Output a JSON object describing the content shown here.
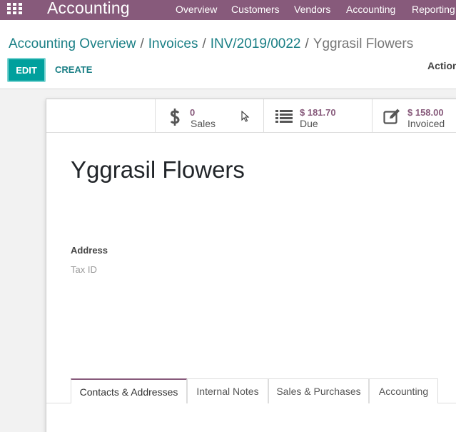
{
  "topbar": {
    "app_title": "Accounting",
    "menu": [
      "Overview",
      "Customers",
      "Vendors",
      "Accounting",
      "Reporting"
    ],
    "apps_icon": "grid-icon"
  },
  "breadcrumb": {
    "items": [
      "Accounting Overview",
      "Invoices",
      "INV/2019/0022"
    ],
    "separator": "/",
    "current": "Yggrasil Flowers"
  },
  "buttons": {
    "edit": "EDIT",
    "create": "CREATE",
    "action": "Action"
  },
  "smart_buttons": [
    {
      "value": "0",
      "label": "Sales",
      "icon": "dollar-icon"
    },
    {
      "value": "$ 181.70",
      "label": "Due",
      "icon": "list-icon"
    },
    {
      "value": "$ 158.00",
      "label": "Invoiced",
      "icon": "edit-icon"
    }
  ],
  "partner": {
    "name": "Yggrasil Flowers",
    "address_label": "Address",
    "tax_id_label": "Tax ID"
  },
  "tabs": [
    "Contacts & Addresses",
    "Internal Notes",
    "Sales & Purchases",
    "Accounting"
  ],
  "colors": {
    "brand": "#875a7b",
    "primary_button": "#00a09d",
    "link": "#1a7f85"
  }
}
